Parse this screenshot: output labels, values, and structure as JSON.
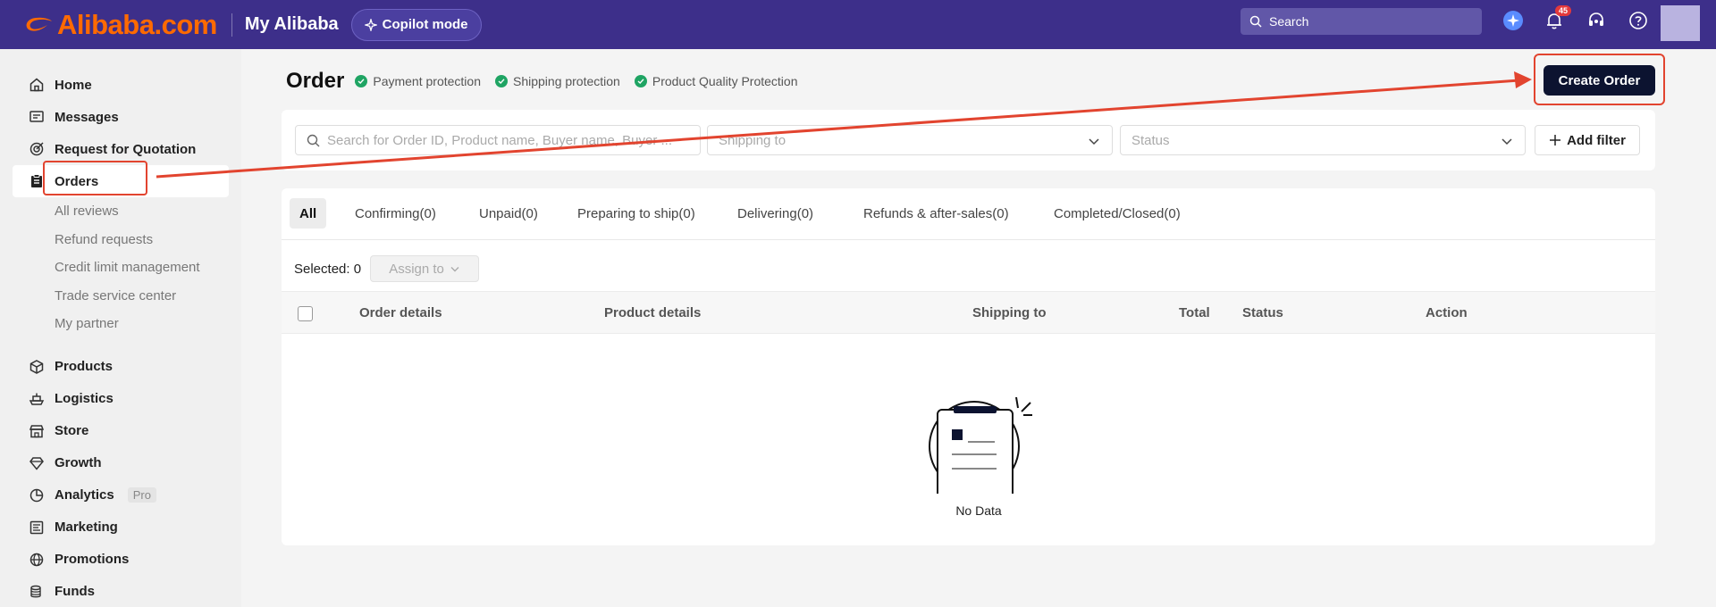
{
  "header": {
    "logo_text": "Alibaba.com",
    "section_title": "My Alibaba",
    "copilot_label": "Copilot mode",
    "search_placeholder": "Search",
    "notification_count": "45",
    "brand_color": "#ff6a00",
    "bar_color": "#3d2f8a",
    "icons": [
      "search-icon",
      "ai-assistant-icon",
      "bell-icon",
      "headset-icon",
      "help-icon"
    ]
  },
  "sidebar": {
    "groups": [
      {
        "label": "Home",
        "icon": "home-icon"
      },
      {
        "label": "Messages",
        "icon": "message-icon"
      },
      {
        "label": "Request for Quotation",
        "icon": "target-icon"
      },
      {
        "label": "Orders",
        "icon": "clipboard-icon",
        "active": true
      }
    ],
    "order_subitems": [
      "All reviews",
      "Refund requests",
      "Credit limit management",
      "Trade service center",
      "My partner"
    ],
    "groups2": [
      {
        "label": "Products",
        "icon": "box-icon"
      },
      {
        "label": "Logistics",
        "icon": "ship-icon"
      },
      {
        "label": "Store",
        "icon": "store-icon"
      },
      {
        "label": "Growth",
        "icon": "diamond-icon"
      },
      {
        "label": "Analytics",
        "icon": "pie-chart-icon",
        "tag": "Pro"
      },
      {
        "label": "Marketing",
        "icon": "marketing-icon"
      },
      {
        "label": "Promotions",
        "icon": "globe-icon"
      },
      {
        "label": "Funds",
        "icon": "coins-icon"
      }
    ]
  },
  "main": {
    "title": "Order",
    "protections": [
      "Payment protection",
      "Shipping protection",
      "Product Quality Protection"
    ],
    "create_order_label": "Create Order",
    "filters": {
      "search_placeholder": "Search for Order ID, Product name, Buyer name, Buyer ...",
      "shipping_placeholder": "Shipping to",
      "status_placeholder": "Status",
      "add_filter_label": "Add filter"
    },
    "tabs": [
      "All",
      "Confirming(0)",
      "Unpaid(0)",
      "Preparing to ship(0)",
      "Delivering(0)",
      "Refunds & after-sales(0)",
      "Completed/Closed(0)"
    ],
    "selected_label": "Selected: 0",
    "assign_label": "Assign to",
    "columns": [
      "Order details",
      "Product details",
      "Shipping to",
      "Total",
      "Status",
      "Action"
    ],
    "empty_label": "No Data"
  },
  "annotation_color": "#e2442f"
}
